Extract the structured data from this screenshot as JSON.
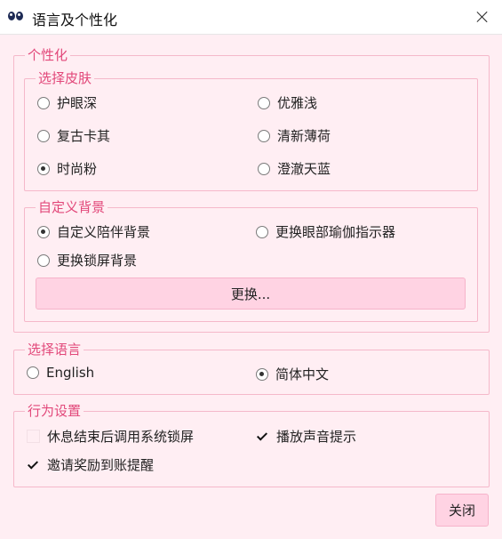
{
  "window": {
    "title": "语言及个性化"
  },
  "personalization": {
    "legend": "个性化",
    "skin": {
      "legend": "选择皮肤",
      "options": [
        "护眼深",
        "优雅浅",
        "复古卡其",
        "清新薄荷",
        "时尚粉",
        "澄澈天蓝"
      ],
      "selected": "时尚粉"
    },
    "background": {
      "legend": "自定义背景",
      "options": [
        "自定义陪伴背景",
        "更换眼部瑜伽指示器",
        "更换锁屏背景"
      ],
      "selected": "自定义陪伴背景",
      "change_button": "更换..."
    }
  },
  "language": {
    "legend": "选择语言",
    "options": [
      "English",
      "简体中文"
    ],
    "selected": "简体中文"
  },
  "behavior": {
    "legend": "行为设置",
    "lock_after_rest": {
      "label": "休息结束后调用系统锁屏",
      "checked": false
    },
    "sound_alert": {
      "label": "播放声音提示",
      "checked": true
    },
    "invite_reward": {
      "label": "邀请奖励到账提醒",
      "checked": true
    }
  },
  "footer": {
    "close_button": "关闭"
  },
  "colors": {
    "background": "#ffeef3",
    "accent": "#e2487a",
    "border": "#f5b8ca",
    "button": "#ffd3e3"
  }
}
